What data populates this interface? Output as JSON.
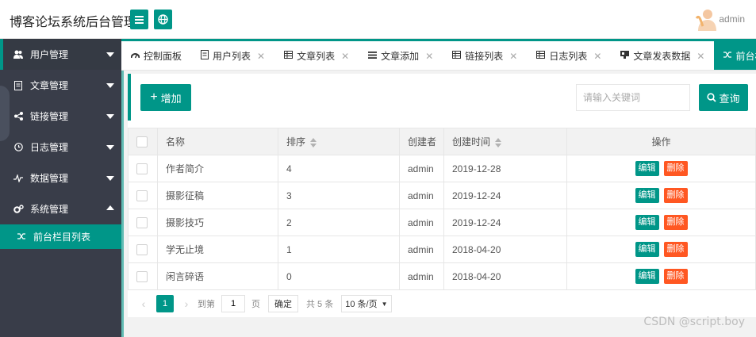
{
  "header": {
    "title": "博客论坛系统后台管理",
    "user_name": "admin"
  },
  "sidebar": {
    "items": [
      {
        "label": "用户管理",
        "icon": "users-icon"
      },
      {
        "label": "文章管理",
        "icon": "file-icon"
      },
      {
        "label": "链接管理",
        "icon": "share-icon"
      },
      {
        "label": "日志管理",
        "icon": "log-icon"
      },
      {
        "label": "数据管理",
        "icon": "pulse-icon"
      },
      {
        "label": "系统管理",
        "icon": "gears-icon"
      }
    ],
    "sub_item": {
      "label": "前台栏目列表",
      "icon": "shuffle-icon"
    }
  },
  "tabs": [
    {
      "label": "控制面板",
      "icon": "dashboard-icon",
      "closable": false
    },
    {
      "label": "用户列表",
      "icon": "list-icon",
      "closable": true
    },
    {
      "label": "文章列表",
      "icon": "table-icon",
      "closable": true
    },
    {
      "label": "文章添加",
      "icon": "bars-icon",
      "closable": true
    },
    {
      "label": "链接列表",
      "icon": "table-icon",
      "closable": true
    },
    {
      "label": "日志列表",
      "icon": "table-icon",
      "closable": true
    },
    {
      "label": "文章发表数据",
      "icon": "chart-icon",
      "closable": true
    },
    {
      "label": "前台栏目列表",
      "icon": "shuffle-icon",
      "closable": false,
      "active": true
    }
  ],
  "toolbar": {
    "add_label": "增加",
    "search_placeholder": "请输入关键词",
    "search_label": "查询"
  },
  "table": {
    "headers": {
      "name": "名称",
      "sort": "排序",
      "creator": "创建者",
      "created": "创建时间",
      "actions": "操作"
    },
    "rows": [
      {
        "name": "作者简介",
        "sort": "4",
        "creator": "admin",
        "created": "2019-12-28"
      },
      {
        "name": "摄影征稿",
        "sort": "3",
        "creator": "admin",
        "created": "2019-12-24"
      },
      {
        "name": "摄影技巧",
        "sort": "2",
        "creator": "admin",
        "created": "2019-12-24"
      },
      {
        "name": "学无止境",
        "sort": "1",
        "creator": "admin",
        "created": "2018-04-20"
      },
      {
        "name": "闲言碎语",
        "sort": "0",
        "creator": "admin",
        "created": "2018-04-20"
      }
    ],
    "edit_label": "编辑",
    "delete_label": "删除"
  },
  "pager": {
    "current": "1",
    "goto_label": "到第",
    "goto_value": "1",
    "page_label": "页",
    "confirm_label": "确定",
    "total_label": "共 5 条",
    "per_page": "10 条/页"
  },
  "watermark": "CSDN @script.boy",
  "colors": {
    "primary": "#009688",
    "danger": "#ff5722",
    "sidebar": "#393d49"
  }
}
